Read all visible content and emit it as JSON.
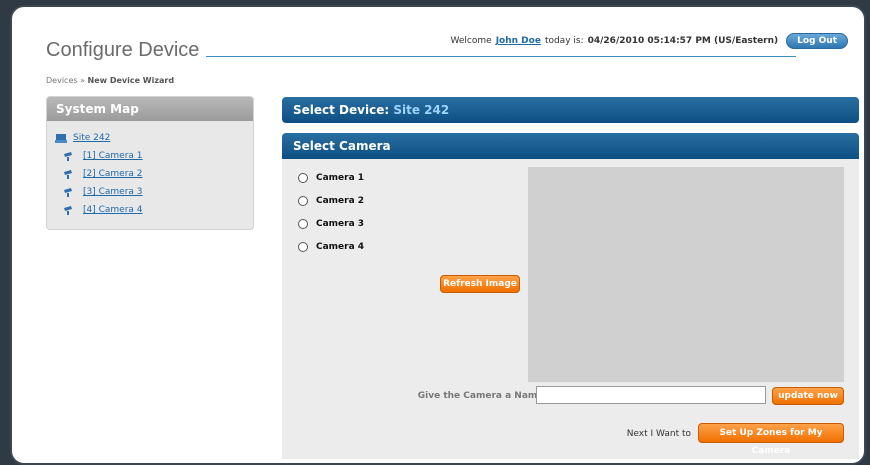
{
  "header": {
    "title": "Configure Device",
    "welcome_prefix": "Welcome",
    "user": "John Doe",
    "today_text": "today is:",
    "datetime": "04/26/2010 05:14:57 PM (US/Eastern)",
    "logout_label": "Log Out"
  },
  "breadcrumb": {
    "parent": "Devices",
    "separator": "»",
    "current": "New Device Wizard"
  },
  "sidebar": {
    "title": "System Map",
    "site": "Site 242",
    "cameras": [
      "[1] Camera 1",
      "[2] Camera 2",
      "[3] Camera 3",
      "[4] Camera 4"
    ]
  },
  "select_device": {
    "label": "Select Device:",
    "value": "Site 242"
  },
  "select_camera": {
    "title": "Select Camera",
    "options": [
      "Camera 1",
      "Camera 2",
      "Camera 3",
      "Camera 4"
    ],
    "refresh_label": "Refresh Image",
    "name_label": "Give the Camera a Name:",
    "name_value": "",
    "update_label": "update now",
    "next_label": "Next I Want to",
    "setup_label": "Set Up Zones for My Camera"
  },
  "colors": {
    "accent_blue": "#0d4f82",
    "orange": "#f07000",
    "link": "#1f6aa8"
  }
}
